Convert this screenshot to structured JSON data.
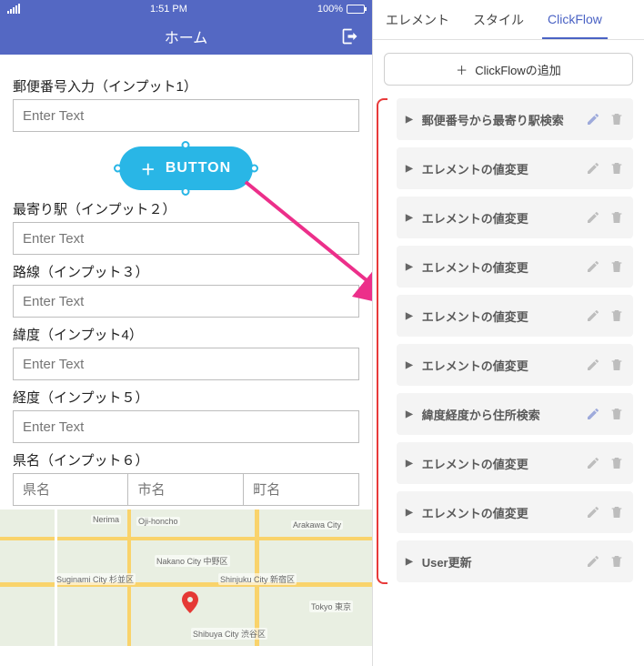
{
  "statusbar": {
    "time": "1:51 PM",
    "battery": "100%"
  },
  "appbar": {
    "title": "ホーム"
  },
  "form": {
    "label1": "郵便番号入力（インプット1）",
    "placeholder": "Enter Text",
    "buttonLabel": "BUTTON",
    "label2": "最寄り駅（インプット２）",
    "label3": "路線（インプット３）",
    "label4": "緯度（インプット4）",
    "label5": "経度（インプット５）",
    "label6": "県名（インプット６）",
    "ph_ken": "県名",
    "ph_shi": "市名",
    "ph_cho": "町名"
  },
  "map": {
    "labels": [
      "Nerima",
      "Nakano City 中野区",
      "Suginami City 杉並区",
      "Shibuya City 渋谷区",
      "Shinjuku City 新宿区",
      "Arakawa City",
      "Oji-honcho",
      "Tokyo 東京"
    ]
  },
  "tabs": {
    "t1": "エレメント",
    "t2": "スタイル",
    "t3": "ClickFlow"
  },
  "addFlowLabel": "ClickFlowの追加",
  "flows": [
    {
      "label": "郵便番号から最寄り駅検索",
      "editHl": true
    },
    {
      "label": "エレメントの値変更"
    },
    {
      "label": "エレメントの値変更"
    },
    {
      "label": "エレメントの値変更"
    },
    {
      "label": "エレメントの値変更"
    },
    {
      "label": "エレメントの値変更"
    },
    {
      "label": "緯度経度から住所検索",
      "editHl": true
    },
    {
      "label": "エレメントの値変更"
    },
    {
      "label": "エレメントの値変更"
    },
    {
      "label": "User更新"
    }
  ]
}
